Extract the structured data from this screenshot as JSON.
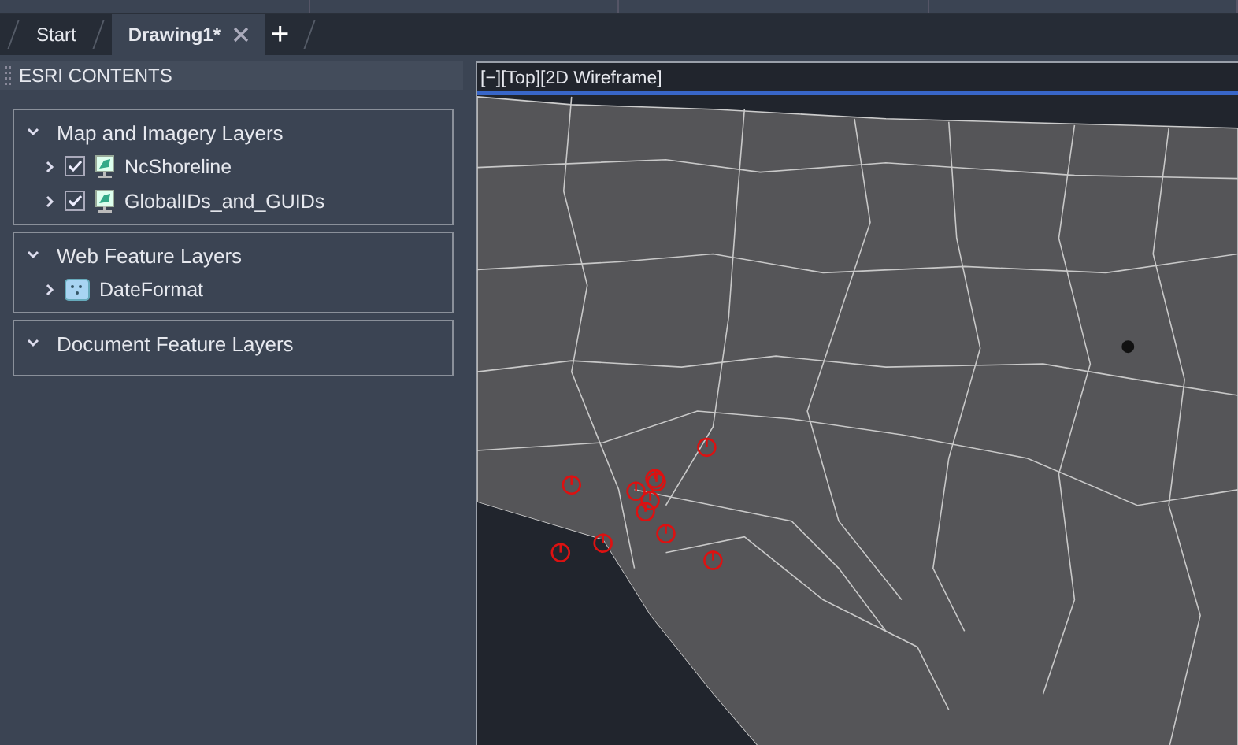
{
  "tabs": [
    {
      "label": "Start",
      "selected": false,
      "closable": false
    },
    {
      "label": "Drawing1*",
      "selected": true,
      "closable": true
    }
  ],
  "new_tab": "+",
  "panel": {
    "title": "ESRI CONTENTS",
    "groups": [
      {
        "title": "Map and Imagery Layers",
        "expanded": true,
        "layers": [
          {
            "name": "NcShoreline",
            "kind": "imagery",
            "checked": true
          },
          {
            "name": "GlobalIDs_and_GUIDs",
            "kind": "imagery",
            "checked": true
          }
        ]
      },
      {
        "title": "Web Feature Layers",
        "expanded": true,
        "layers": [
          {
            "name": "DateFormat",
            "kind": "feature"
          }
        ]
      },
      {
        "title": "Document Feature Layers",
        "expanded": true
      }
    ]
  },
  "viewport": {
    "caption": "[−][Top][2D Wireframe]"
  }
}
